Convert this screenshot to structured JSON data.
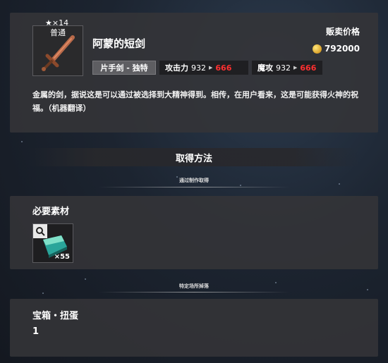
{
  "item": {
    "rarity_stars": "★×14",
    "rarity_label": "普通",
    "name": "阿蒙的短剑",
    "icon": "sword-icon",
    "type_tag": "片手剑 - 独特",
    "attack": {
      "label": "攻击力",
      "base": "932",
      "boosted": "666"
    },
    "magic": {
      "label": "魔攻",
      "base": "932",
      "boosted": "666"
    },
    "description": "金属的剑，据说这是可以通过被选择到大精神得到。相传，在用户看来，这是可能获得火神的祝福。（机器翻译）"
  },
  "sell": {
    "label": "贩卖价格",
    "price": "792000",
    "icon": "gold-coin-icon"
  },
  "acquire": {
    "title": "取得方法",
    "craft_heading": "通过制作取得",
    "materials_title": "必要素材",
    "materials": [
      {
        "icon": "teal-ingot-icon",
        "quantity": "×55"
      }
    ],
    "drop_heading": "特定场所掉落",
    "drop_title": "宝箱・扭蛋",
    "drop_value": "1"
  },
  "colors": {
    "boost": "#ff3030",
    "panel": "#343438",
    "coin": "#d9a12a"
  }
}
